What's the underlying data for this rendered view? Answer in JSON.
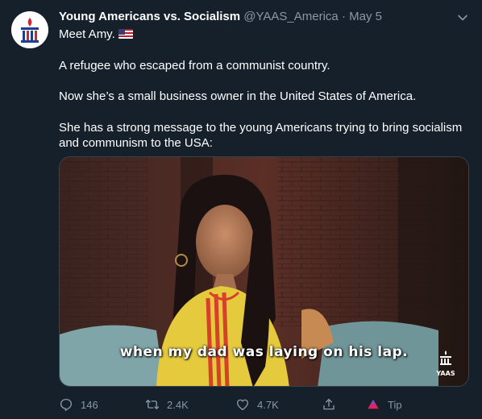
{
  "tweet": {
    "author_name": "Young Americans vs. Socialism",
    "handle": "@YAAS_America",
    "separator": "·",
    "date": "May 5",
    "line1": "Meet Amy.",
    "line2": "A refugee who escaped from a communist country.",
    "line3": "Now she’s a small business owner in the United States of America.",
    "line4a": "She has a strong message to the young Americans trying to bring socialism",
    "line4b": "and communism to the USA:"
  },
  "media": {
    "caption": "when my dad was laying on his lap.",
    "watermark": "YAAS"
  },
  "actions": {
    "replies": "146",
    "retweets": "2.4K",
    "likes": "4.7K",
    "tip_label": "Tip"
  },
  "icons": {
    "reply": "reply-icon",
    "retweet": "retweet-icon",
    "like": "heart-icon",
    "share": "share-icon",
    "tip": "tip-icon",
    "more": "chevron-down-icon"
  },
  "colors": {
    "background": "#15202b",
    "secondary_text": "#8899a6",
    "tip_icon": "#e0245e"
  }
}
